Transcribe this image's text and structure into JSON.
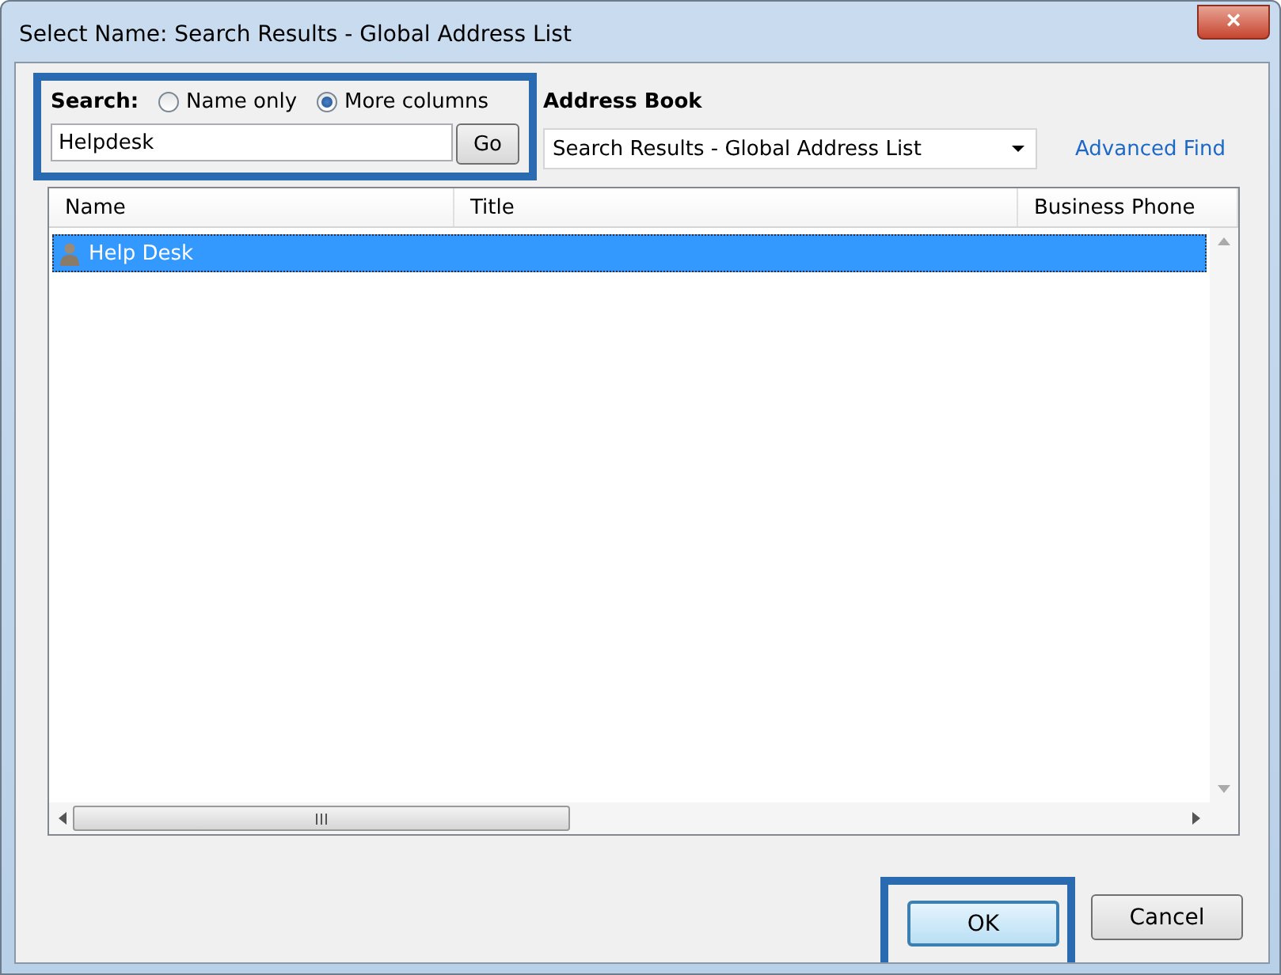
{
  "window": {
    "title": "Select Name: Search Results - Global Address List",
    "close": "×"
  },
  "search": {
    "label": "Search:",
    "options": [
      {
        "label": "Name only",
        "selected": false
      },
      {
        "label": "More columns",
        "selected": true
      }
    ],
    "value": "Helpdesk",
    "go": "Go"
  },
  "address_book": {
    "label": "Address Book",
    "value": "Search Results - Global Address List",
    "advanced_find": "Advanced Find"
  },
  "table": {
    "columns": [
      "Name",
      "Title",
      "Business Phone"
    ],
    "rows": [
      {
        "name": "Help Desk",
        "selected": true
      }
    ]
  },
  "buttons": [
    {
      "label": "OK",
      "default": true
    },
    {
      "label": "Cancel",
      "default": false
    }
  ]
}
